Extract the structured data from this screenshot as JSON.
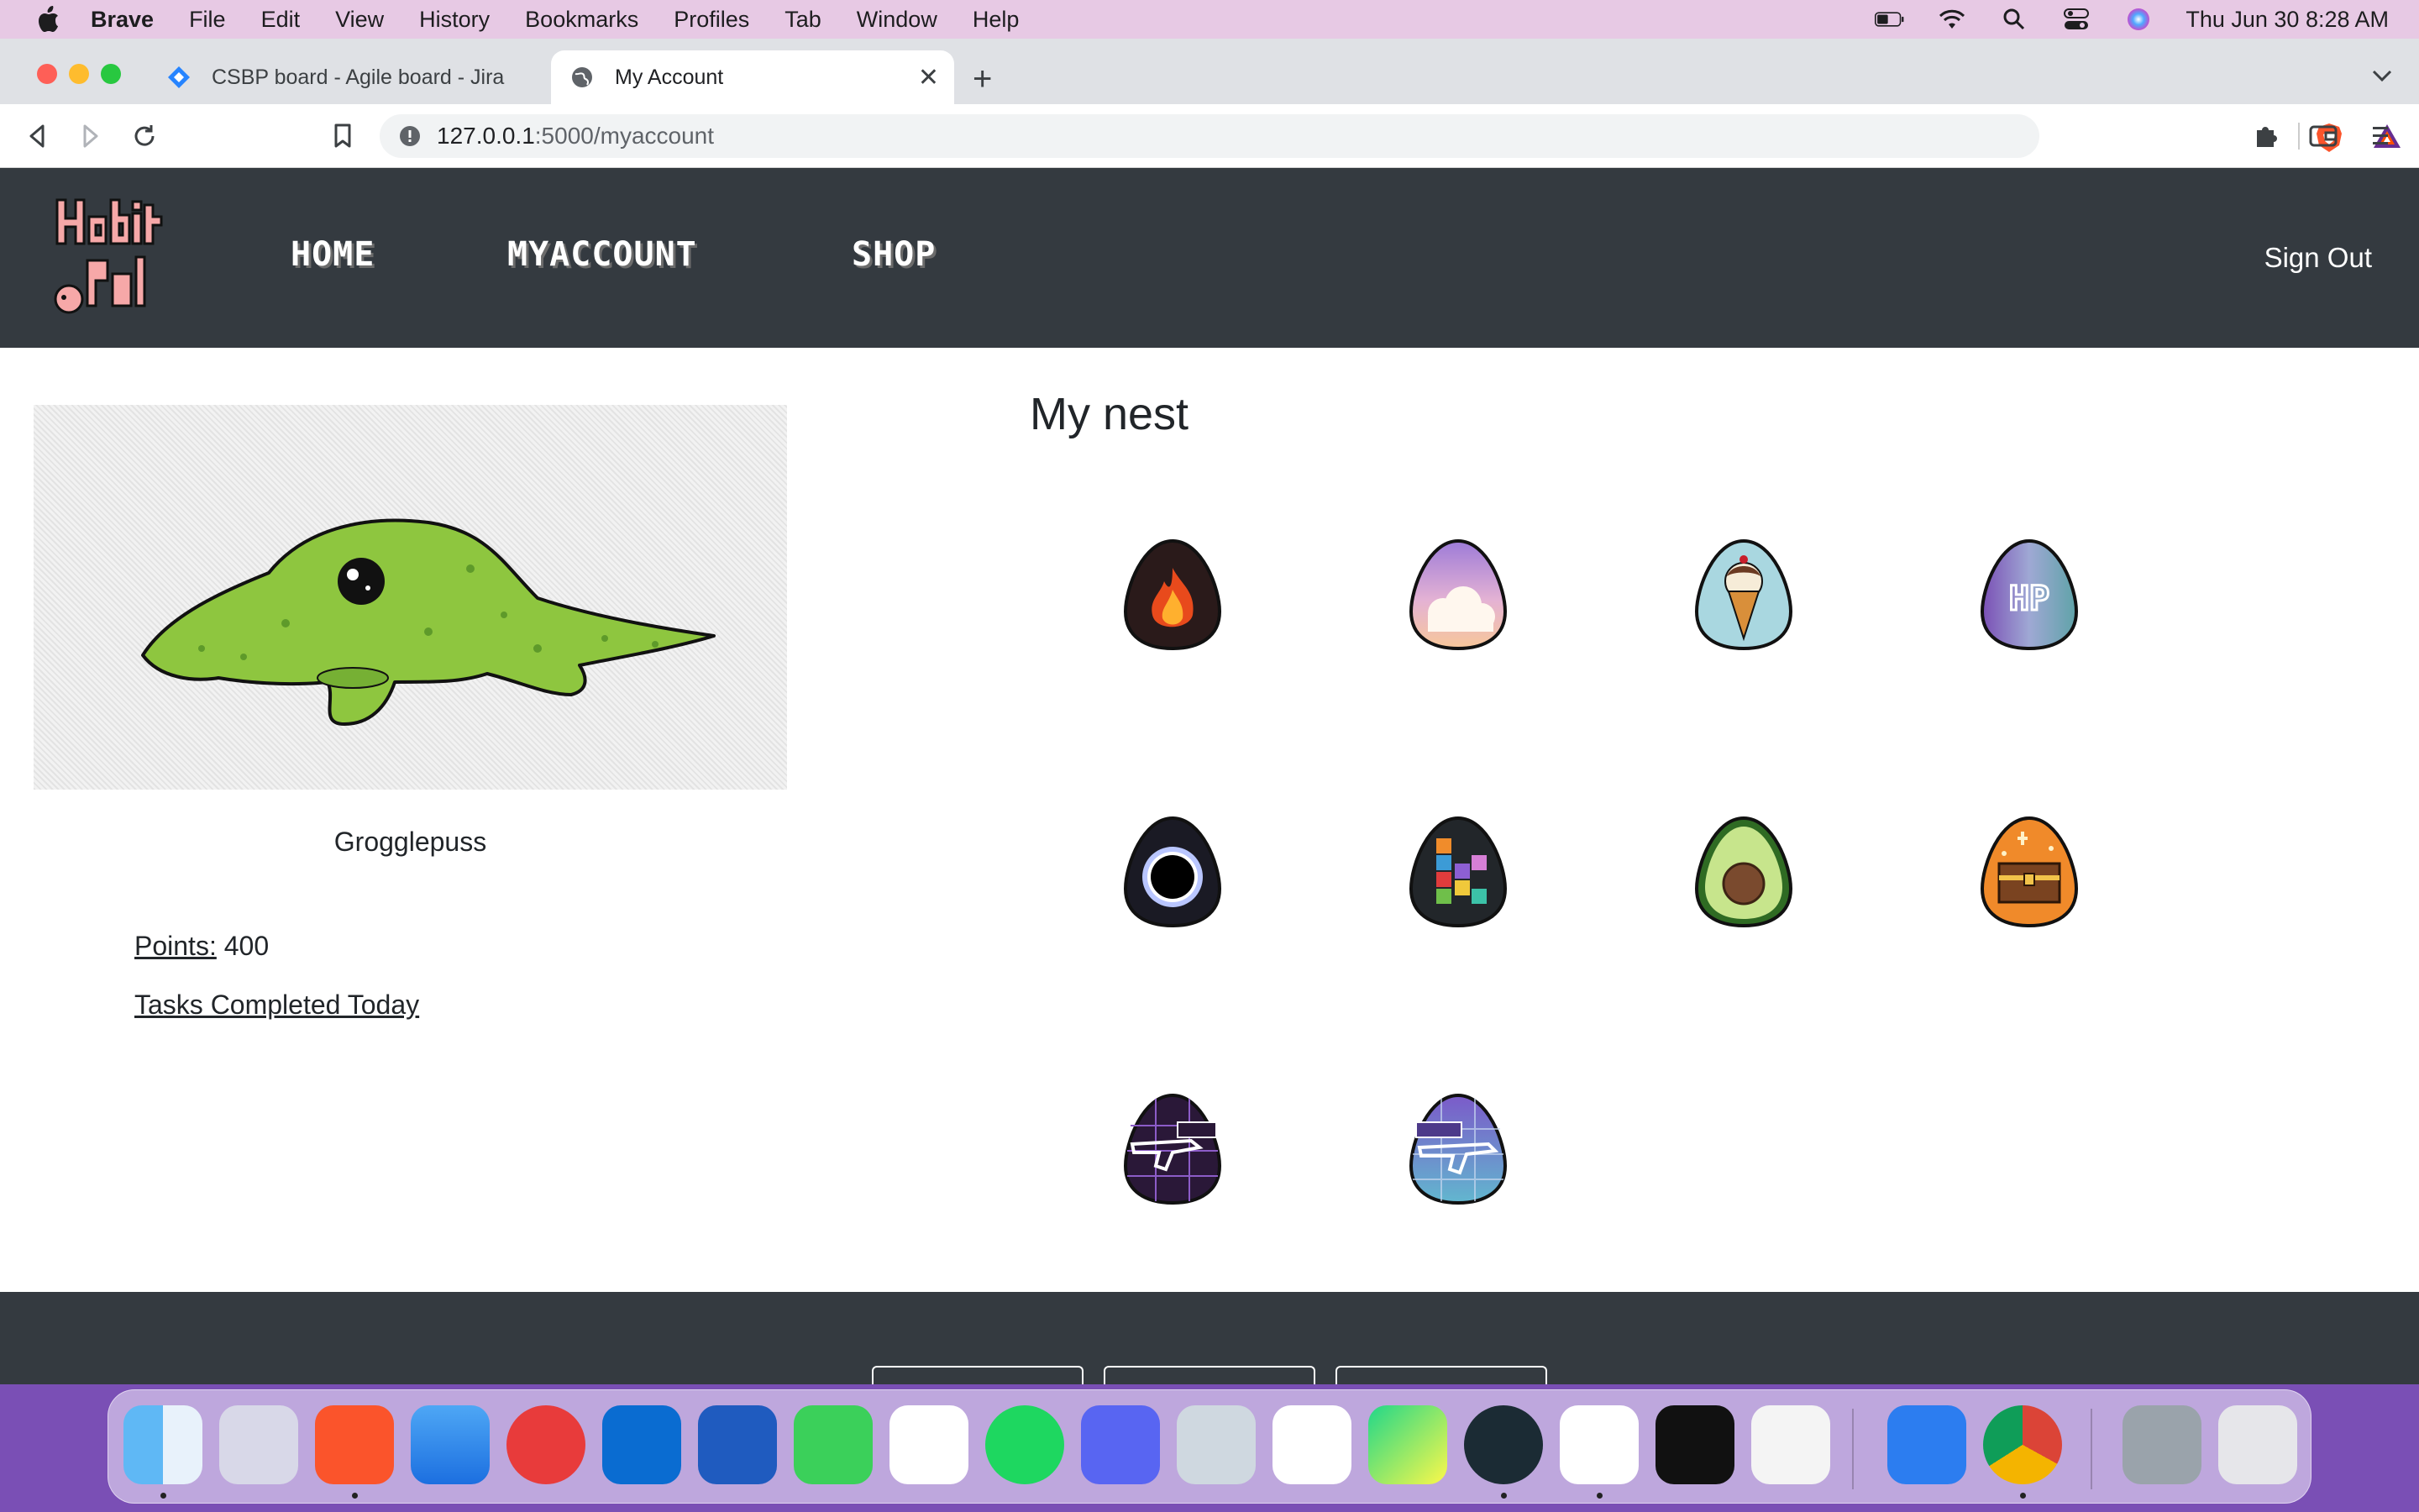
{
  "menubar": {
    "app": "Brave",
    "items": [
      "File",
      "Edit",
      "View",
      "History",
      "Bookmarks",
      "Profiles",
      "Tab",
      "Window",
      "Help"
    ],
    "clock": "Thu Jun 30  8:28 AM"
  },
  "browser": {
    "tabs": [
      {
        "title": "CSBP board - Agile board - Jira",
        "icon": "jira-icon"
      },
      {
        "title": "My Account",
        "icon": "globe-icon"
      }
    ],
    "url_host": "127.0.0.1",
    "url_path": ":5000/myaccount"
  },
  "site": {
    "nav": {
      "home": "HOME",
      "myaccount": "MYACCOUNT",
      "shop": "SHOP",
      "signout": "Sign Out"
    },
    "pet": {
      "name": "Grogglepuss"
    },
    "stats": {
      "points_label": "Points:",
      "points_value": "400",
      "tasks_label": "Tasks Completed Today"
    },
    "nest": {
      "title": "My nest",
      "eggs": [
        "fire-egg",
        "cloud-egg",
        "ice-cream-egg",
        "hp-egg",
        "black-hole-egg",
        "blocks-egg",
        "avocado-egg",
        "treasure-chest-egg",
        "ak47-egg",
        "m4a4-egg"
      ]
    }
  },
  "dock": {
    "apps": [
      "Finder",
      "Launchpad",
      "Brave",
      "Mail",
      "Airmail",
      "Outlook",
      "Word",
      "Messages",
      "Photos",
      "Spotify",
      "Discord",
      "Preview",
      "Slack",
      "PyCharm",
      "GitKraken",
      "VS Code",
      "Terminal",
      "TextEdit",
      "Xcode",
      "Chrome",
      "Downloads",
      "Trash"
    ]
  },
  "colors": {
    "navbar": "#343a40",
    "menubar": "#e7c9e4",
    "dock_bg": "#7a4fb5"
  }
}
